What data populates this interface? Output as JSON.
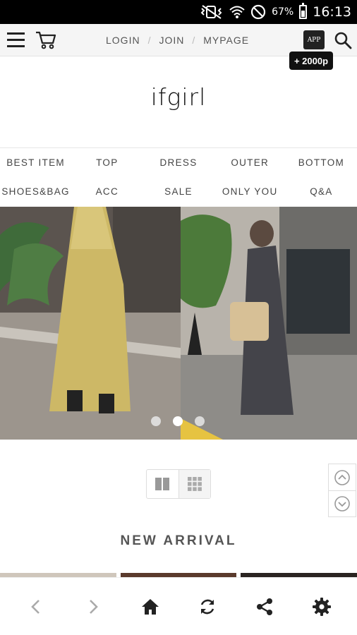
{
  "status_bar": {
    "battery": "67%",
    "time": "16:13"
  },
  "header": {
    "links": [
      "LOGIN",
      "JOIN",
      "MYPAGE"
    ],
    "app_icon_label": "APP",
    "app_badge": "+ 2000p"
  },
  "logo": "ifgirl",
  "categories": {
    "row1": [
      "BEST ITEM",
      "TOP",
      "DRESS",
      "OUTER",
      "BOTTOM"
    ],
    "row2": [
      "SHOES&BAG",
      "ACC",
      "SALE",
      "ONLY YOU",
      "Q&A"
    ]
  },
  "banner": {
    "slides": 3,
    "active_slide": 2
  },
  "section_title": "NEW ARRIVAL",
  "icons": {
    "menu": "hamburger-icon",
    "cart": "cart-icon",
    "search": "search-icon",
    "back": "chevron-left-icon",
    "forward": "chevron-right-icon",
    "home": "home-icon",
    "refresh": "refresh-icon",
    "share": "share-icon",
    "settings": "gear-icon"
  }
}
